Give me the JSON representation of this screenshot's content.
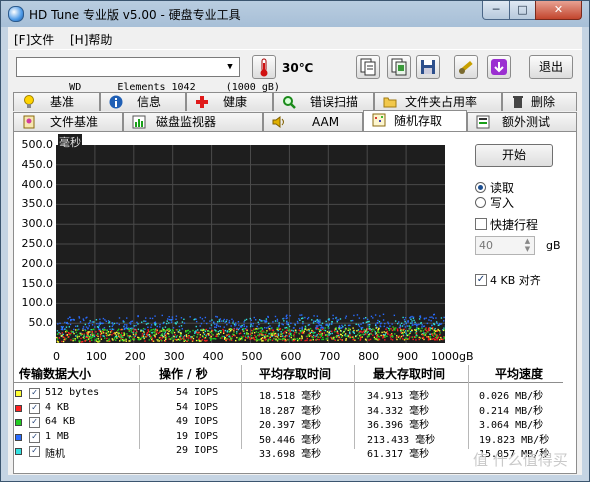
{
  "window": {
    "title": "HD Tune 专业版 v5.00 - 硬盘专业工具",
    "min_label": "─",
    "max_label": "□",
    "close_label": "✕"
  },
  "menu": [
    {
      "label": "[F]文件"
    },
    {
      "label": "[H]帮助"
    }
  ],
  "toolbar": {
    "drive": "WD      Elements 1042     (1000 gB)",
    "drive_arrow": "▼",
    "temperature": "30℃",
    "exit_label": "退出",
    "icons": [
      "thermometer-icon",
      "copy-text-icon",
      "copy-screen-icon",
      "save-icon",
      "options-icon",
      "download-icon"
    ]
  },
  "tabs_row1": [
    {
      "label": "基准",
      "icon": "lightbulb-icon"
    },
    {
      "label": "信息",
      "icon": "info-icon"
    },
    {
      "label": "健康",
      "icon": "health-cross-icon"
    },
    {
      "label": "错误扫描",
      "icon": "magnifier-icon"
    },
    {
      "label": "文件夹占用率",
      "icon": "folder-icon"
    },
    {
      "label": "删除",
      "icon": "trash-icon"
    }
  ],
  "tabs_row2": [
    {
      "label": "文件基准",
      "icon": "file-benchmark-icon"
    },
    {
      "label": "磁盘监视器",
      "icon": "monitor-chart-icon"
    },
    {
      "label": "AAM",
      "icon": "speaker-icon"
    },
    {
      "label": "随机存取",
      "icon": "random-access-icon",
      "active": true
    },
    {
      "label": "额外测试",
      "icon": "extra-test-icon"
    }
  ],
  "controls": {
    "start_label": "开始",
    "read_label": "读取",
    "write_label": "写入",
    "read_selected": true,
    "short_stroke_label": "快捷行程",
    "short_stroke_checked": false,
    "short_stroke_value": "40",
    "short_stroke_unit": "gB",
    "align_label": "4 KB 对齐",
    "align_checked": true
  },
  "chart_data": {
    "type": "scatter",
    "ylabel": "毫秒",
    "xlabel": "",
    "x_unit_label": "1000gB",
    "yticks": [
      "500.0",
      "450.0",
      "400.0",
      "350.0",
      "300.0",
      "250.0",
      "200.0",
      "150.0",
      "100.0",
      "50.0"
    ],
    "xticks": [
      "0",
      "100",
      "200",
      "300",
      "400",
      "500",
      "600",
      "700",
      "800",
      "900",
      "1000gB"
    ],
    "xlim": [
      0,
      1000
    ],
    "ylim": [
      0,
      500
    ],
    "grid": true,
    "background": "#1e1e1e",
    "grid_color": "#4a4a4a",
    "series": [
      {
        "name": "512 bytes",
        "color": "#ffff33",
        "y_band": [
          4,
          35
        ]
      },
      {
        "name": "4 KB",
        "color": "#ff2020",
        "y_band": [
          4,
          35
        ]
      },
      {
        "name": "64 KB",
        "color": "#22cc22",
        "y_band": [
          6,
          37
        ]
      },
      {
        "name": "1 MB",
        "color": "#2a6cff",
        "y_band": [
          35,
          70
        ]
      },
      {
        "name": "随机",
        "color": "#33e0e0",
        "y_band": [
          15,
          61
        ]
      }
    ]
  },
  "table": {
    "headers": [
      "传输数据大小",
      "操作 / 秒",
      "平均存取时间",
      "最大存取时间",
      "平均速度"
    ],
    "rows": [
      {
        "size": "512 bytes",
        "color": "#ffff33",
        "checked": true,
        "ops": "54 IOPS",
        "avg": "18.518 毫秒",
        "max": "34.913 毫秒",
        "speed": "0.026 MB/秒"
      },
      {
        "size": "4 KB",
        "color": "#ff2020",
        "checked": true,
        "ops": "54 IOPS",
        "avg": "18.287 毫秒",
        "max": "34.332 毫秒",
        "speed": "0.214 MB/秒"
      },
      {
        "size": "64 KB",
        "color": "#22cc22",
        "checked": true,
        "ops": "49 IOPS",
        "avg": "20.397 毫秒",
        "max": "36.396 毫秒",
        "speed": "3.064 MB/秒"
      },
      {
        "size": "1 MB",
        "color": "#2a6cff",
        "checked": true,
        "ops": "19 IOPS",
        "avg": "50.446 毫秒",
        "max": "213.433 毫秒",
        "speed": "19.823 MB/秒"
      },
      {
        "size": "随机",
        "color": "#33e0e0",
        "checked": true,
        "ops": "29 IOPS",
        "avg": "33.698 毫秒",
        "max": "61.317 毫秒",
        "speed": "15.057 MB/秒"
      }
    ]
  },
  "watermark": "值 什么值得买"
}
